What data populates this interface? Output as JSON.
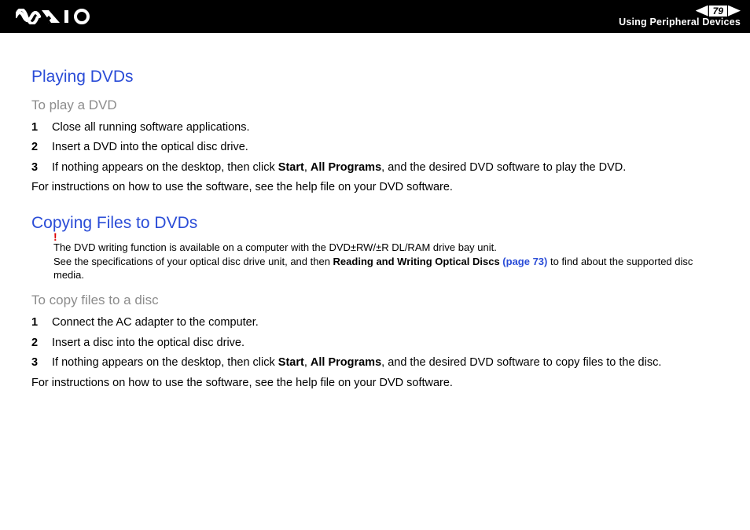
{
  "header": {
    "page_number": "79",
    "section_title": "Using Peripheral Devices"
  },
  "sections": {
    "playing": {
      "title": "Playing DVDs",
      "subtitle": "To play a DVD",
      "steps": [
        {
          "n": "1",
          "text": "Close all running software applications."
        },
        {
          "n": "2",
          "text": "Insert a DVD into the optical disc drive."
        },
        {
          "n": "3",
          "pre": "If nothing appears on the desktop, then click ",
          "b1": "Start",
          "mid": ", ",
          "b2": "All Programs",
          "post": ", and the desired DVD software to play the DVD."
        }
      ],
      "note": "For instructions on how to use the software, see the help file on your DVD software."
    },
    "copying": {
      "title": "Copying Files to DVDs",
      "alert": {
        "line1": "The DVD writing function is available on a computer with the DVD±RW/±R DL/RAM drive bay unit.",
        "line2_pre": "See the specifications of your optical disc drive unit, and then ",
        "line2_bold": "Reading and Writing Optical Discs ",
        "line2_link": "(page 73)",
        "line2_post": " to find about the supported disc media."
      },
      "subtitle": "To copy files to a disc",
      "steps": [
        {
          "n": "1",
          "text": "Connect the AC adapter to the computer."
        },
        {
          "n": "2",
          "text": "Insert a disc into the optical disc drive."
        },
        {
          "n": "3",
          "pre": "If nothing appears on the desktop, then click ",
          "b1": "Start",
          "mid": ", ",
          "b2": "All Programs",
          "post": ", and the desired DVD software to copy files to the disc."
        }
      ],
      "note": "For instructions on how to use the software, see the help file on your DVD software."
    }
  }
}
